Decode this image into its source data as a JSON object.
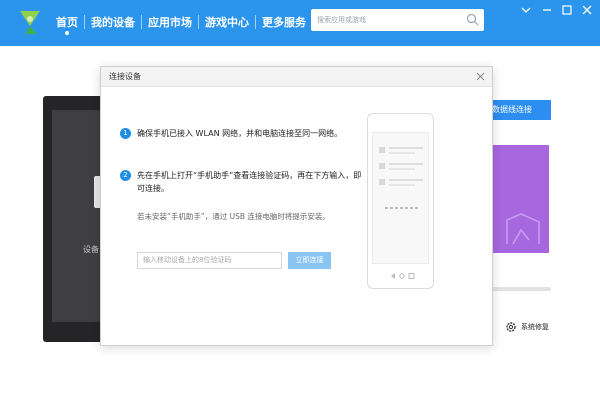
{
  "nav": {
    "items": [
      {
        "label": "首页",
        "active": true
      },
      {
        "label": "我的设备",
        "active": false
      },
      {
        "label": "应用市场",
        "active": false
      },
      {
        "label": "游戏中心",
        "active": false
      },
      {
        "label": "更多服务",
        "active": false
      }
    ]
  },
  "search": {
    "placeholder": "搜索应用或游戏"
  },
  "background": {
    "device_hint": "设备",
    "wireless_button": "数据线连接",
    "system_repair": "系统修复"
  },
  "dialog": {
    "title": "连接设备",
    "steps": [
      {
        "num": "1",
        "text": "确保手机已接入 WLAN 网络，并和电脑连接至同一网络。"
      },
      {
        "num": "2",
        "text": "先在手机上打开“手机助手”查看连接验证码，再在下方输入，即可连接。"
      }
    ],
    "hint": "若未安装“手机助手”，通过 USB 连接电脑时将提示安装。",
    "code_placeholder": "输入移动设备上的8位验证码",
    "connect_button": "立即连接"
  },
  "colors": {
    "brand_blue": "#2b95ee",
    "accent_purple": "#a767df",
    "step_blue": "#1f8fe6"
  }
}
